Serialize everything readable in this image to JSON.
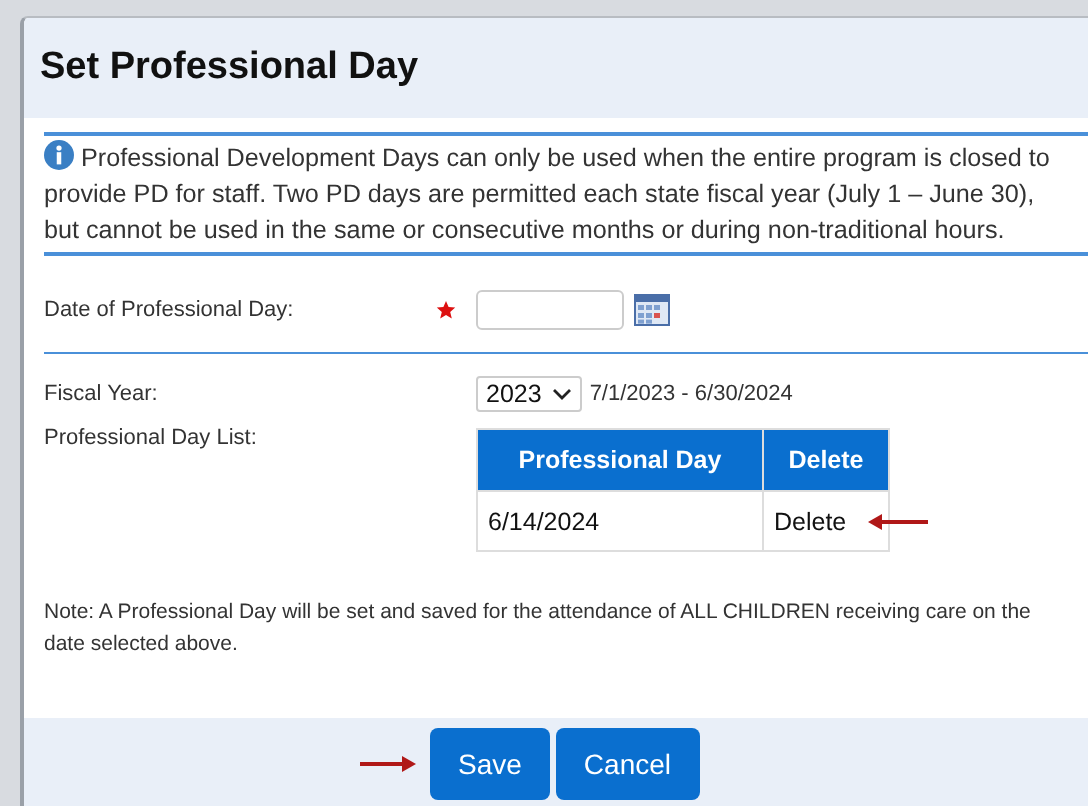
{
  "dialog": {
    "title": "Set Professional Day"
  },
  "info": "Professional Development Days can only be used when the entire program is closed to provide PD for staff. Two PD days are permitted each state fiscal year (July 1 – June 30), but cannot be used in the same or consecutive months or during non-traditional hours.",
  "date_field": {
    "label": "Date of Professional Day:",
    "required": true
  },
  "fiscal_year": {
    "label": "Fiscal Year:",
    "value": "2023",
    "range": "7/1/2023 - 6/30/2024"
  },
  "day_list": {
    "label": "Professional Day List:",
    "columns": [
      "Professional Day",
      "Delete"
    ],
    "rows": [
      {
        "date": "6/14/2024",
        "action": "Delete"
      }
    ]
  },
  "note": "Note: A Professional Day will be set and saved for the attendance of ALL CHILDREN receiving care on the date selected above.",
  "buttons": [
    "Save",
    "Cancel"
  ]
}
